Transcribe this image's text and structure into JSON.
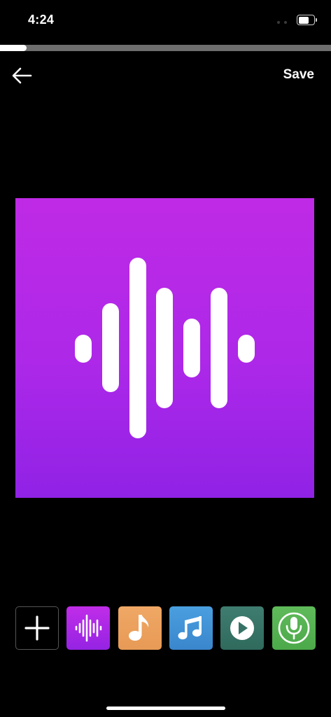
{
  "status_bar": {
    "time": "4:24",
    "battery_level": 0.7
  },
  "progress": {
    "fraction": 0.08
  },
  "header": {
    "back_icon": "arrow-left-icon",
    "save_label": "Save"
  },
  "artwork": {
    "icon": "sound-wave-icon",
    "gradient_top": "#bf2ae6",
    "gradient_bottom": "#9022e6",
    "bar_color": "#ffffff"
  },
  "toolbar": {
    "items": [
      {
        "id": "add",
        "icon": "plus-icon",
        "bg": "#000000"
      },
      {
        "id": "wave",
        "icon": "sound-wave-icon",
        "bg": "#b029e6"
      },
      {
        "id": "note",
        "icon": "eighth-note-icon",
        "bg": "#eba25e"
      },
      {
        "id": "music",
        "icon": "beamed-notes-icon",
        "bg": "#4294d8"
      },
      {
        "id": "play",
        "icon": "play-circle-icon",
        "bg": "#367366"
      },
      {
        "id": "mic",
        "icon": "microphone-icon",
        "bg": "#56b152"
      }
    ]
  }
}
